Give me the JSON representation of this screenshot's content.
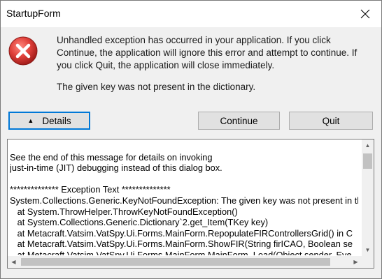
{
  "window": {
    "title": "StartupForm",
    "close_icon": "close-icon"
  },
  "message": {
    "icon": "error-icon",
    "text": "Unhandled exception has occurred in your application. If you click Continue, the application will ignore this error and attempt to continue. If you click Quit, the application will close immediately.",
    "detail": "The given key was not present in the dictionary."
  },
  "buttons": {
    "details_label": "Details",
    "details_icon": "triangle-up-icon",
    "continue_label": "Continue",
    "quit_label": "Quit"
  },
  "details": {
    "lines": [
      "See the end of this message for details on invoking",
      "just-in-time (JIT) debugging instead of this dialog box.",
      "",
      "************** Exception Text **************",
      "System.Collections.Generic.KeyNotFoundException: The given key was not present in the dictionary.",
      "   at System.ThrowHelper.ThrowKeyNotFoundException()",
      "   at System.Collections.Generic.Dictionary`2.get_Item(TKey key)",
      "   at Metacraft.Vatsim.VatSpy.Ui.Forms.MainForm.RepopulateFIRControllersGrid() in C",
      "   at Metacraft.Vatsim.VatSpy.Ui.Forms.MainForm.ShowFIR(String firICAO, Boolean se",
      "   at Metacraft.Vatsim.VatSpy.Ui.Forms.MainForm.MainForm_Load(Object sender, Eve"
    ]
  },
  "colors": {
    "accent": "#0078d7",
    "error_red": "#d9302c"
  }
}
